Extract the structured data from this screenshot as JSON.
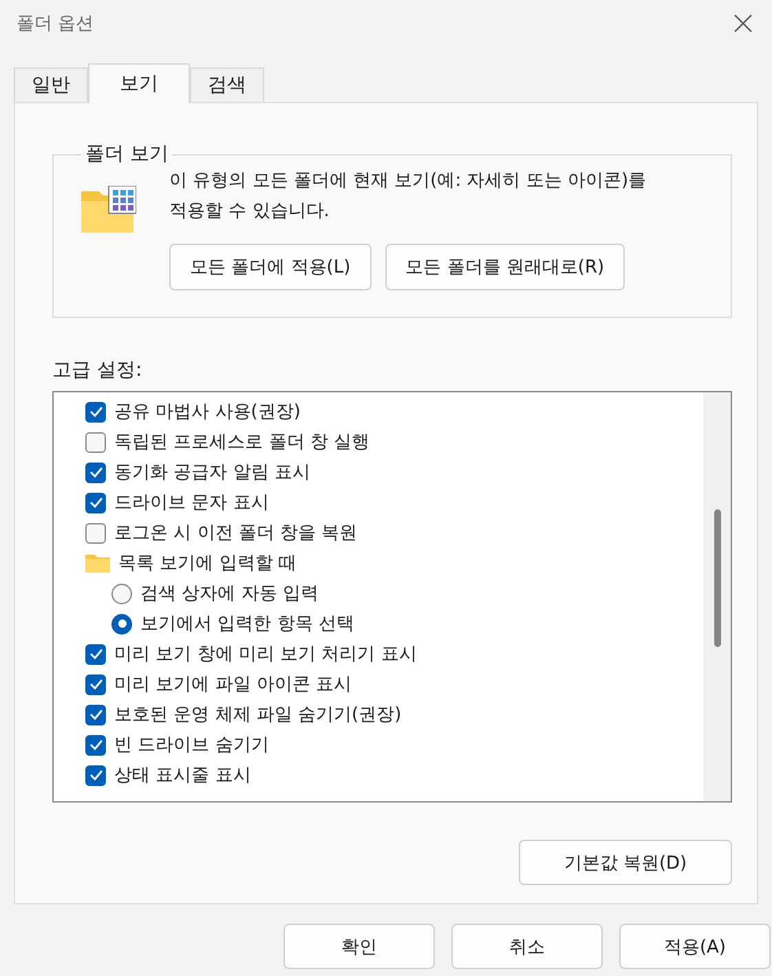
{
  "window": {
    "title": "폴더 옵션"
  },
  "tabs": [
    {
      "label": "일반",
      "selected": false
    },
    {
      "label": "보기",
      "selected": true
    },
    {
      "label": "검색",
      "selected": false
    }
  ],
  "folder_views": {
    "title": "폴더 보기",
    "description": "이 유형의 모든 폴더에 현재 보기(예: 자세히 또는 아이콘)를 적용할 수 있습니다.",
    "buttons": [
      "모든 폴더에 적용(L)",
      "모든 폴더를 원래대로(R)"
    ]
  },
  "advanced": {
    "label": "고급 설정:",
    "items": [
      {
        "kind": "checkbox",
        "label": "공유 마법사 사용(권장)",
        "checked": true
      },
      {
        "kind": "checkbox",
        "label": "독립된 프로세스로 폴더 창 실행",
        "checked": false
      },
      {
        "kind": "checkbox",
        "label": "동기화 공급자 알림 표시",
        "checked": true
      },
      {
        "kind": "checkbox",
        "label": "드라이브 문자 표시",
        "checked": true
      },
      {
        "kind": "checkbox",
        "label": "로그온 시 이전 폴더 창을 복원",
        "checked": false
      },
      {
        "kind": "folder",
        "label": "목록 보기에 입력할 때",
        "children": [
          {
            "kind": "radio",
            "label": "검색 상자에 자동 입력",
            "selected": false
          },
          {
            "kind": "radio",
            "label": "보기에서 입력한 항목 선택",
            "selected": true
          }
        ]
      },
      {
        "kind": "checkbox",
        "label": "미리 보기 창에 미리 보기 처리기 표시",
        "checked": true
      },
      {
        "kind": "checkbox",
        "label": "미리 보기에 파일 아이콘 표시",
        "checked": true
      },
      {
        "kind": "checkbox",
        "label": "보호된 운영 체제 파일 숨기기(권장)",
        "checked": true
      },
      {
        "kind": "checkbox",
        "label": "빈 드라이브 숨기기",
        "checked": true
      },
      {
        "kind": "checkbox",
        "label": "상태 표시줄 표시",
        "checked": true
      }
    ],
    "restore_button": "기본값 복원(D)"
  },
  "buttons": [
    "확인",
    "취소",
    "적용(A)"
  ]
}
